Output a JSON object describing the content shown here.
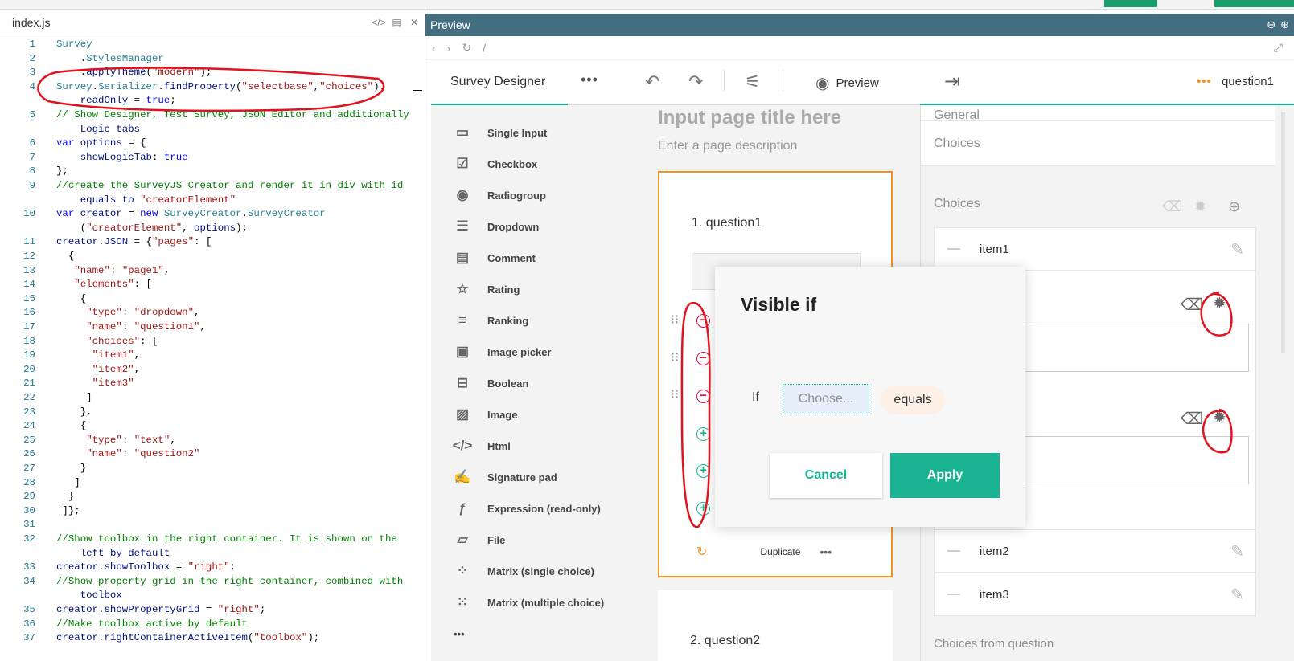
{
  "editor": {
    "filename": "index.js",
    "lines": [
      {
        "n": "1",
        "t": "Survey"
      },
      {
        "n": "2",
        "t": "    .StylesManager"
      },
      {
        "n": "3",
        "t": "    .applyTheme(\"modern\");"
      },
      {
        "n": "4",
        "t": "Survey.Serializer.findProperty(\"selectbase\",\"choices\")."
      },
      {
        "n": "",
        "t": "    readOnly = true;"
      },
      {
        "n": "5",
        "t": "// Show Designer, Test Survey, JSON Editor and additionally"
      },
      {
        "n": "",
        "t": "    Logic tabs"
      },
      {
        "n": "6",
        "t": "var options = {"
      },
      {
        "n": "7",
        "t": "    showLogicTab: true"
      },
      {
        "n": "8",
        "t": "};"
      },
      {
        "n": "9",
        "t": "//create the SurveyJS Creator and render it in div with id"
      },
      {
        "n": "",
        "t": "    equals to \"creatorElement\""
      },
      {
        "n": "10",
        "t": "var creator = new SurveyCreator.SurveyCreator"
      },
      {
        "n": "",
        "t": "    (\"creatorElement\", options);"
      },
      {
        "n": "11",
        "t": "creator.JSON = {\"pages\": ["
      },
      {
        "n": "12",
        "t": "  {"
      },
      {
        "n": "13",
        "t": "   \"name\": \"page1\","
      },
      {
        "n": "14",
        "t": "   \"elements\": ["
      },
      {
        "n": "15",
        "t": "    {"
      },
      {
        "n": "16",
        "t": "     \"type\": \"dropdown\","
      },
      {
        "n": "17",
        "t": "     \"name\": \"question1\","
      },
      {
        "n": "18",
        "t": "     \"choices\": ["
      },
      {
        "n": "19",
        "t": "      \"item1\","
      },
      {
        "n": "20",
        "t": "      \"item2\","
      },
      {
        "n": "21",
        "t": "      \"item3\""
      },
      {
        "n": "22",
        "t": "     ]"
      },
      {
        "n": "23",
        "t": "    },"
      },
      {
        "n": "24",
        "t": "    {"
      },
      {
        "n": "25",
        "t": "     \"type\": \"text\","
      },
      {
        "n": "26",
        "t": "     \"name\": \"question2\""
      },
      {
        "n": "27",
        "t": "    }"
      },
      {
        "n": "28",
        "t": "   ]"
      },
      {
        "n": "29",
        "t": "  }"
      },
      {
        "n": "30",
        "t": " ]};"
      },
      {
        "n": "31",
        "t": ""
      },
      {
        "n": "32",
        "t": "//Show toolbox in the right container. It is shown on the"
      },
      {
        "n": "",
        "t": "    left by default"
      },
      {
        "n": "33",
        "t": "creator.showToolbox = \"right\";"
      },
      {
        "n": "34",
        "t": "//Show property grid in the right container, combined with"
      },
      {
        "n": "",
        "t": "    toolbox"
      },
      {
        "n": "35",
        "t": "creator.showPropertyGrid = \"right\";"
      },
      {
        "n": "36",
        "t": "//Make toolbox active by default"
      },
      {
        "n": "37",
        "t": "creator.rightContainerActiveItem(\"toolbox\");"
      }
    ]
  },
  "preview": {
    "title": "Preview",
    "path": "/"
  },
  "creator": {
    "designer_tab": "Survey Designer",
    "preview_label": "Preview",
    "toolbox": [
      {
        "label": "Single Input",
        "icon": "single-input-icon",
        "glyph": "▭"
      },
      {
        "label": "Checkbox",
        "icon": "checkbox-icon",
        "glyph": "☑"
      },
      {
        "label": "Radiogroup",
        "icon": "radiogroup-icon",
        "glyph": "◉"
      },
      {
        "label": "Dropdown",
        "icon": "dropdown-icon",
        "glyph": "☰"
      },
      {
        "label": "Comment",
        "icon": "comment-icon",
        "glyph": "▤"
      },
      {
        "label": "Rating",
        "icon": "rating-icon",
        "glyph": "☆"
      },
      {
        "label": "Ranking",
        "icon": "ranking-icon",
        "glyph": "≡"
      },
      {
        "label": "Image picker",
        "icon": "image-picker-icon",
        "glyph": "▣"
      },
      {
        "label": "Boolean",
        "icon": "boolean-icon",
        "glyph": "⊟"
      },
      {
        "label": "Image",
        "icon": "image-icon",
        "glyph": "▨"
      },
      {
        "label": "Html",
        "icon": "html-icon",
        "glyph": "</>"
      },
      {
        "label": "Signature pad",
        "icon": "signature-icon",
        "glyph": "✍"
      },
      {
        "label": "Expression (read-only)",
        "icon": "expression-icon",
        "glyph": "ƒ"
      },
      {
        "label": "File",
        "icon": "file-icon",
        "glyph": "▱"
      },
      {
        "label": "Matrix (single choice)",
        "icon": "matrix-single-icon",
        "glyph": "⁘"
      },
      {
        "label": "Matrix (multiple choice)",
        "icon": "matrix-multiple-icon",
        "glyph": "⁙"
      }
    ],
    "page_title": "Input page title here",
    "page_description": "Enter a page description",
    "question1_title": "1. question1",
    "question2_title": "2. question2",
    "duplicate_label": "Duplicate"
  },
  "property_grid": {
    "object_name": "question1",
    "section_general": "General",
    "section_choices": "Choices",
    "choices_header": "Choices",
    "items": [
      "item1",
      "item2",
      "item3"
    ],
    "choices_from_question": "Choices from question"
  },
  "modal": {
    "title": "Visible if",
    "if_label": "If",
    "choose_placeholder": "Choose...",
    "operator": "equals",
    "cancel_label": "Cancel",
    "apply_label": "Apply"
  },
  "colors": {
    "accent": "#19b394",
    "selection": "#f5931f",
    "remove": "#e50a3e",
    "annotation": "#e0141e",
    "preview_header": "#436e7f"
  }
}
